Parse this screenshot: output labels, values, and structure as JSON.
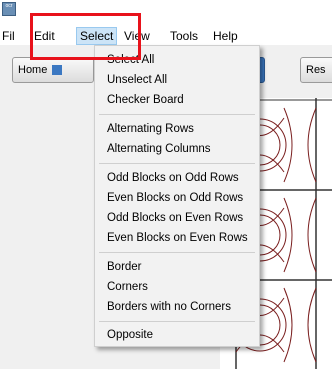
{
  "app": {
    "icon_text": "ocr"
  },
  "menubar": {
    "items": [
      {
        "label": "File",
        "display": "File"
      },
      {
        "label": "Edit"
      },
      {
        "label": "Select"
      },
      {
        "label": "View"
      },
      {
        "label": "Tools"
      },
      {
        "label": "Help"
      }
    ]
  },
  "toolbar": {
    "home_label": "Home",
    "right_label": "Res"
  },
  "select_menu": {
    "items": [
      "Select All",
      "Unselect All",
      "Checker Board",
      "Alternating Rows",
      "Alternating Columns",
      "Odd Blocks on Odd Rows",
      "Even Blocks on Odd Rows",
      "Odd Blocks on Even Rows",
      "Even Blocks on Even Rows",
      "Border",
      "Corners",
      "Borders with no Corners",
      "Opposite"
    ]
  },
  "colors": {
    "highlight_box": "#e8121b",
    "menu_active": "#cce4f7",
    "pattern_stroke": "#7a1f1f"
  }
}
